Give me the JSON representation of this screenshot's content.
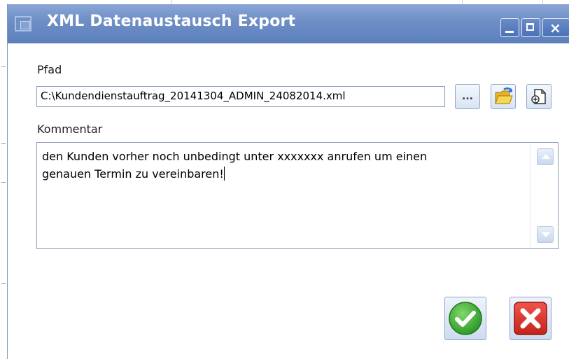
{
  "window": {
    "title": "XML Datenaustausch Export",
    "controls": {
      "minimize": "minimize",
      "maximize": "maximize",
      "close": "×"
    }
  },
  "form": {
    "path_label": "Pfad",
    "path_value": "C:\\Kundendienstauftrag_20141304_ADMIN_24082014.xml",
    "browse_label": "...",
    "comment_label": "Kommentar",
    "comment_value": "den Kunden vorher noch unbedingt unter xxxxxxx anrufen um einen\ngenauen Termin zu vereinbaren!"
  },
  "icons": {
    "app": "app-window-icon",
    "open_folder": "open-folder-icon",
    "new_document": "new-document-icon",
    "ok": "checkmark-icon",
    "cancel": "close-x-icon"
  },
  "colors": {
    "titlebar": "#6f8fc6",
    "ok_green": "#3aa832",
    "cancel_red": "#d9322a"
  }
}
